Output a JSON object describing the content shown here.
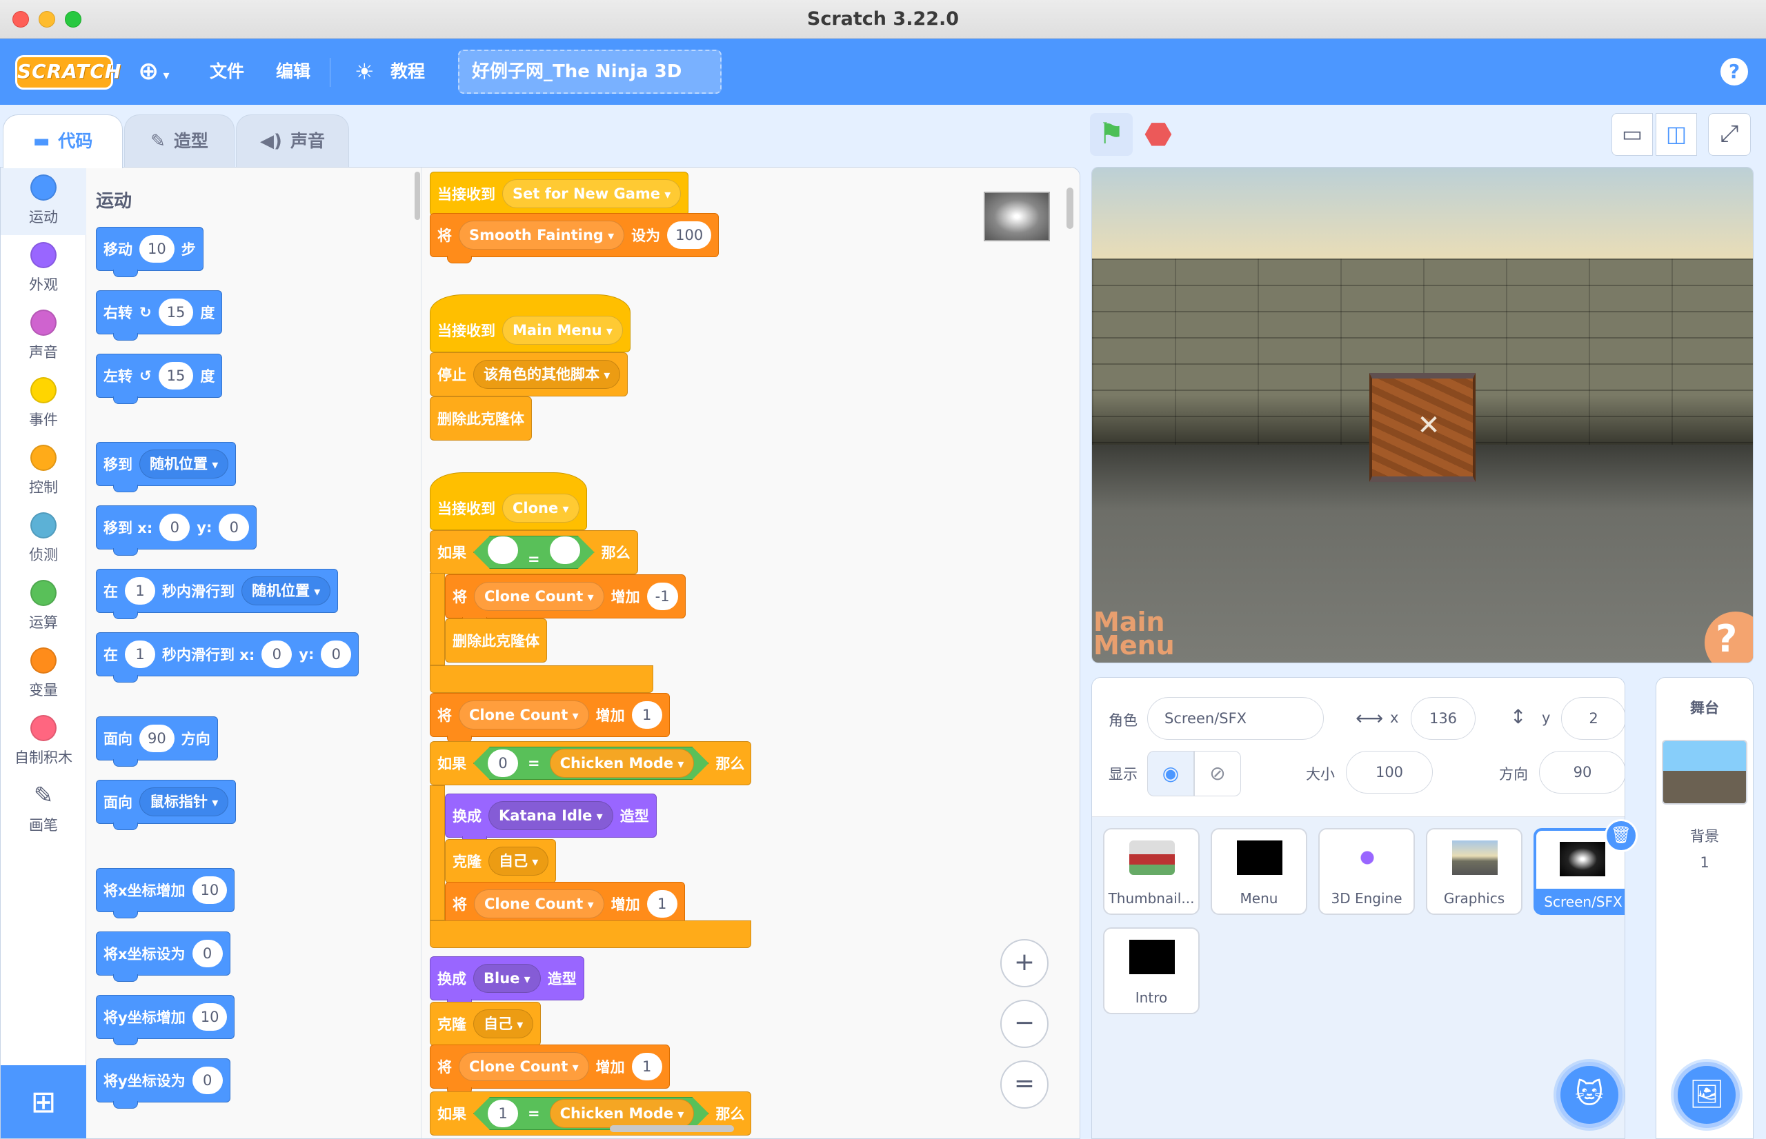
{
  "window": {
    "title": "Scratch 3.22.0"
  },
  "colors": {
    "accent": "#4c97ff",
    "motion": "#4c97ff",
    "looks": "#9966ff",
    "events": "#ffbf00",
    "control": "#ffab19",
    "variables": "#ff8c1a",
    "operators": "#59c059"
  },
  "menubar": {
    "logo": "SCRATCH",
    "file": "文件",
    "edit": "编辑",
    "tutorials": "教程",
    "project_title": "好例子网_The Ninja 3D",
    "help": "?"
  },
  "tabs": {
    "code": "代码",
    "costumes": "造型",
    "sounds": "声音"
  },
  "categories": [
    {
      "label": "运动",
      "color": "#4c97ff"
    },
    {
      "label": "外观",
      "color": "#9966ff"
    },
    {
      "label": "声音",
      "color": "#cf63cf"
    },
    {
      "label": "事件",
      "color": "#ffd500"
    },
    {
      "label": "控制",
      "color": "#ffab19"
    },
    {
      "label": "侦测",
      "color": "#5cb1d6"
    },
    {
      "label": "运算",
      "color": "#59c059"
    },
    {
      "label": "变量",
      "color": "#ff8c1a"
    },
    {
      "label": "自制积木",
      "color": "#ff6680"
    },
    {
      "label": "画笔",
      "color": "#0fbd8c"
    }
  ],
  "palette": {
    "heading": "运动",
    "move": {
      "a": "移动",
      "v": "10",
      "b": "步"
    },
    "turn_right": {
      "a": "右转",
      "v": "15",
      "b": "度"
    },
    "turn_left": {
      "a": "左转",
      "v": "15",
      "b": "度"
    },
    "goto": {
      "a": "移到",
      "dd": "随机位置"
    },
    "goto_xy": {
      "a": "移到 x:",
      "x": "0",
      "y_label": "y:",
      "y": "0"
    },
    "glide": {
      "a": "在",
      "v": "1",
      "b": "秒内滑行到",
      "dd": "随机位置"
    },
    "glide_xy": {
      "a": "在",
      "v": "1",
      "b": "秒内滑行到 x:",
      "x": "0",
      "y_label": "y:",
      "y": "0"
    },
    "point_dir": {
      "a": "面向",
      "v": "90",
      "b": "方向"
    },
    "point_towards": {
      "a": "面向",
      "dd": "鼠标指针"
    },
    "change_x": {
      "a": "将x坐标增加",
      "v": "10"
    },
    "set_x": {
      "a": "将x坐标设为",
      "v": "0"
    },
    "change_y": {
      "a": "将y坐标增加",
      "v": "10"
    },
    "set_y": {
      "a": "将y坐标设为",
      "v": "0"
    }
  },
  "script": {
    "s1_hat": {
      "a": "当接收到",
      "dd": "Set for New Game"
    },
    "s1_set": {
      "a": "将",
      "dd": "Smooth Fainting",
      "b": "设为",
      "v": "100"
    },
    "s2_hat": {
      "a": "当接收到",
      "dd": "Main Menu"
    },
    "s2_stop": {
      "a": "停止",
      "dd": "该角色的其他脚本"
    },
    "s2_del": {
      "a": "删除此克隆体"
    },
    "s3_hat": {
      "a": "当接收到",
      "dd": "Clone"
    },
    "s3_if1": {
      "a": "如果",
      "op": "=",
      "b": "那么"
    },
    "s3_change1": {
      "a": "将",
      "dd": "Clone Count",
      "b": "增加",
      "v": "-1"
    },
    "s3_del": {
      "a": "删除此克隆体"
    },
    "s3_change2": {
      "a": "将",
      "dd": "Clone Count",
      "b": "增加",
      "v": "1"
    },
    "s3_if2": {
      "a": "如果",
      "l": "0",
      "op": "=",
      "r": "Chicken Mode",
      "b": "那么"
    },
    "s3_switch": {
      "a": "换成",
      "dd": "Katana Idle",
      "b": "造型"
    },
    "s3_clone": {
      "a": "克隆",
      "dd": "自己"
    },
    "s3_change3": {
      "a": "将",
      "dd": "Clone Count",
      "b": "增加",
      "v": "1"
    },
    "s3_switch2": {
      "a": "换成",
      "dd": "Blue",
      "b": "造型"
    },
    "s3_clone2": {
      "a": "克隆",
      "dd": "自己"
    },
    "s3_change4": {
      "a": "将",
      "dd": "Clone Count",
      "b": "增加",
      "v": "1"
    },
    "s3_if3": {
      "a": "如果",
      "l": "1",
      "op": "=",
      "r": "Chicken Mode",
      "b": "那么"
    }
  },
  "zoom": {
    "in": "+",
    "out": "−",
    "reset": "="
  },
  "stage_overlay": {
    "main_menu": "Main Menu",
    "question": "?"
  },
  "sprite_info": {
    "sprite_label": "角色",
    "sprite_name": "Screen/SFX",
    "x_label": "x",
    "x": "136",
    "y_label": "y",
    "y": "2",
    "show_label": "显示",
    "size_label": "大小",
    "size": "100",
    "direction_label": "方向",
    "direction": "90"
  },
  "sprites": [
    "Thumbnail...",
    "Menu",
    "3D Engine",
    "Graphics",
    "Screen/SFX",
    "Intro"
  ],
  "stage_pane": {
    "label": "舞台",
    "backdrop_label": "背景",
    "backdrop_count": "1"
  }
}
